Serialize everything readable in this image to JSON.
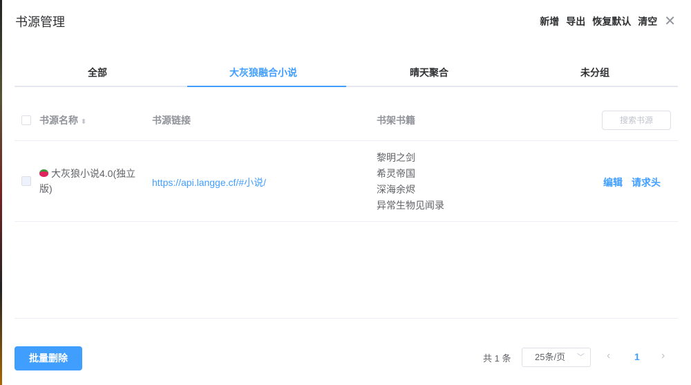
{
  "title": "书源管理",
  "actions": {
    "add": "新增",
    "export": "导出",
    "restore": "恢复默认",
    "clear": "清空"
  },
  "tabs": [
    "全部",
    "大灰狼融合小说",
    "晴天聚合",
    "未分组"
  ],
  "table": {
    "headers": {
      "name": "书源名称",
      "url": "书源链接",
      "books": "书架书籍"
    },
    "search_placeholder": "搜索书源",
    "rows": [
      {
        "name": "大灰狼小说4.0(独立版)",
        "url": "https://api.langge.cf/#小说/",
        "books": [
          "黎明之剑",
          "希灵帝国",
          "深海余烬",
          "异常生物见闻录"
        ],
        "edit": "编辑",
        "headers": "请求头"
      }
    ]
  },
  "footer": {
    "batch_delete": "批量删除",
    "total": "共 1 条",
    "page_size": "25条/页",
    "current_page": "1"
  },
  "accent": "#409eff"
}
